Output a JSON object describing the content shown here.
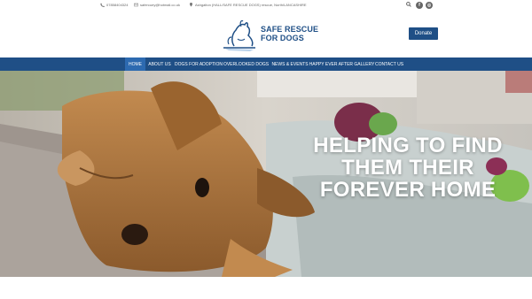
{
  "topbar": {
    "phone": "07858404324",
    "email": "safercuey@hotmail.co.uk",
    "address": "Ashgalton (HALL/SAFE RESCUE DOGS) rescue, North/LANCASHIRE"
  },
  "site": {
    "name_line1": "SAFE RESCUE",
    "name_line2": "FOR DOGS"
  },
  "header": {
    "donate_label": "Donate"
  },
  "nav": {
    "items": [
      {
        "label": "HOME"
      },
      {
        "label": "ABOUT US"
      },
      {
        "label": "DOGS FOR ADOPTION"
      },
      {
        "label": "OVERLOOKED DOGS"
      },
      {
        "label": "NEWS & EVENTS"
      },
      {
        "label": "HAPPY EVER AFTER GALLERY"
      },
      {
        "label": "CONTACT US"
      }
    ]
  },
  "hero": {
    "headline_line1": "HELPING TO FIND",
    "headline_line2": "THEM THEIR",
    "headline_line3": "FOREVER HOME"
  },
  "colors": {
    "brand": "#1f4f86",
    "nav_active": "#2d6ab0"
  },
  "icons": [
    "phone-icon",
    "mail-icon",
    "location-icon",
    "search-icon",
    "facebook-icon",
    "instagram-icon"
  ]
}
